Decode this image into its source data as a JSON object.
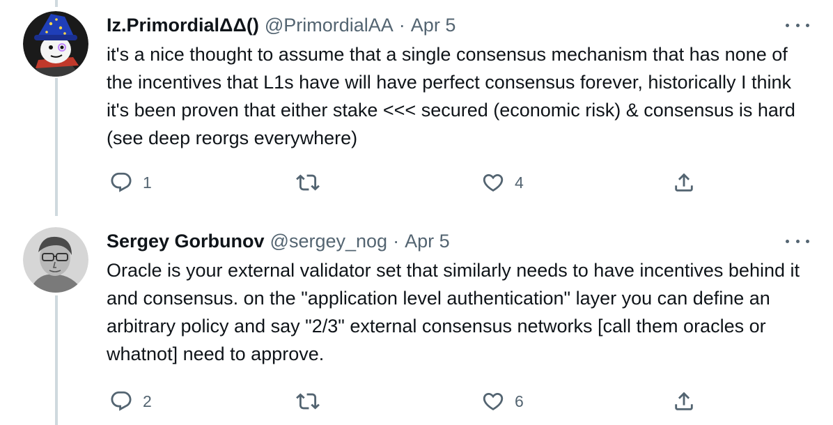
{
  "colors": {
    "text_primary": "#0f1419",
    "text_secondary": "#536471",
    "thread_line": "#cfd9de"
  },
  "tweets": [
    {
      "display_name": "Iz.PrimordialΔΔ()",
      "handle": "@PrimordialAA",
      "separator": "·",
      "date": "Apr 5",
      "text": "it's a nice thought to assume that a single consensus mechanism that has none of the incentives that L1s have will have perfect consensus forever, historically I think it's been proven that either stake <<< secured (economic risk) & consensus is hard (see deep reorgs everywhere)",
      "reply_count": "1",
      "retweet_count": "",
      "like_count": "4",
      "icons": [
        "reply-icon",
        "retweet-icon",
        "like-icon",
        "share-icon",
        "more-icon"
      ]
    },
    {
      "display_name": "Sergey Gorbunov",
      "handle": "@sergey_nog",
      "separator": "·",
      "date": "Apr 5",
      "text": "Oracle is your external validator set that similarly needs to have incentives behind it and consensus. on the \"application level authentication\" layer you can define an arbitrary policy and say \"2/3\" external consensus networks [call them oracles or whatnot] need to approve.",
      "reply_count": "2",
      "retweet_count": "",
      "like_count": "6",
      "icons": [
        "reply-icon",
        "retweet-icon",
        "like-icon",
        "share-icon",
        "more-icon"
      ]
    }
  ]
}
